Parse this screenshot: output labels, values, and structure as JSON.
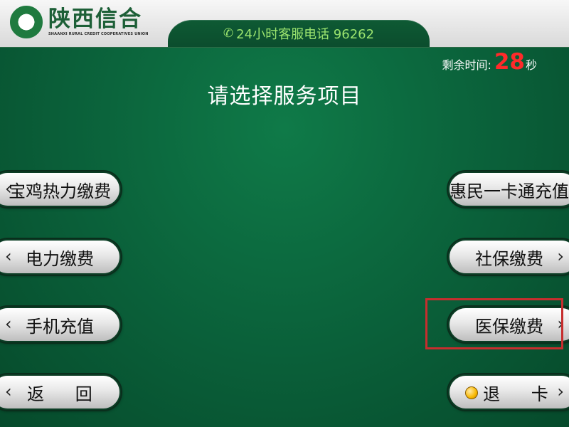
{
  "header": {
    "logo_cn": "陕西信合",
    "logo_en": "SHAANXI RURAL CREDIT COOPERATIVES UNION",
    "hotline_text": "24小时客服电话 96262",
    "hotline_icon": "phone-icon"
  },
  "countdown": {
    "label": "剩余时间:",
    "value": "28",
    "unit": "秒"
  },
  "page": {
    "title": "请选择服务项目"
  },
  "left_menu": [
    {
      "label": "宝鸡热力缴费",
      "icon": "chevron-left-icon"
    },
    {
      "label": "电力缴费",
      "icon": "chevron-left-icon"
    },
    {
      "label": "手机充值",
      "icon": "chevron-left-icon"
    },
    {
      "label": "返 回",
      "icon": "chevron-left-icon"
    }
  ],
  "right_menu": [
    {
      "label": "惠民一卡通充值",
      "icon": "chevron-right-icon"
    },
    {
      "label": "社保缴费",
      "icon": "chevron-right-icon"
    },
    {
      "label": "医保缴费",
      "icon": "chevron-right-icon"
    },
    {
      "label": "退 卡",
      "icon": "chevron-right-icon",
      "indicator_icon": "orange-circle-icon"
    }
  ],
  "colors": {
    "background_green": "#0a5f39",
    "header_gray": "#e2e2e2",
    "hotline_green": "#9be36e",
    "countdown_red": "#ff2a2a",
    "focus_red": "#c62e2e",
    "button_gray": "#e8e8e8"
  }
}
